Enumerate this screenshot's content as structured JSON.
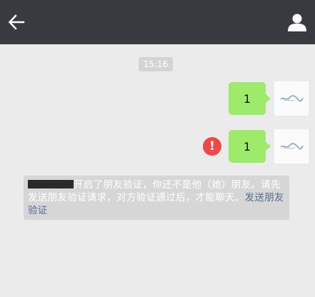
{
  "header": {
    "back_icon": "arrow-left-icon",
    "profile_icon": "person-icon"
  },
  "chat": {
    "timestamp": "15:16",
    "messages": [
      {
        "text": "1",
        "status": "sent"
      },
      {
        "text": "1",
        "status": "failed",
        "error_icon": "!"
      }
    ]
  },
  "system_notice": {
    "text": "开启了朋友验证，你还不是他（她）朋友。请先发送朋友验证请求，对方验证通过后，才能聊天。",
    "link": "发送朋友验证"
  },
  "colors": {
    "topbar": "#393a3f",
    "background": "#ebebeb",
    "bubble": "#9eea6a",
    "error": "#f04848",
    "link": "#576b95"
  }
}
